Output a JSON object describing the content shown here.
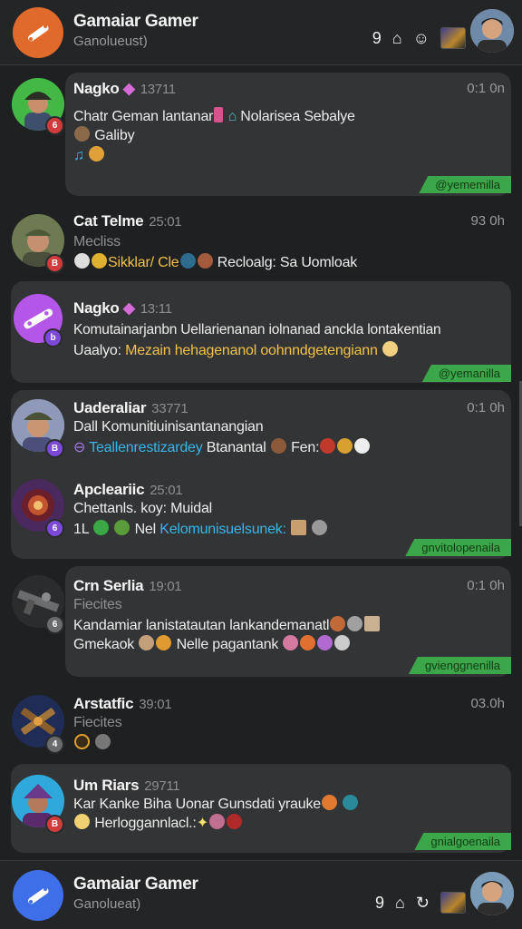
{
  "header": {
    "title": "Gamaiar Gamer",
    "subtitle": "Ganolueust)",
    "icon_q": "9",
    "logo_color": "#e06a2c"
  },
  "footer": {
    "title": "Gamaiar Gamer",
    "subtitle": "Ganolueat)",
    "icon_q": "9",
    "logo_color": "#3f6fe8"
  },
  "messages": [
    {
      "name": "Nagko",
      "time": "13711",
      "right": "0:1 0n",
      "lines": [
        "Chatr Geman lantanar",
        "Nolarisea Sebalye",
        "Galiby"
      ],
      "tag": "@yememilla"
    },
    {
      "name": "Cat Telme",
      "time": "25:01",
      "right": "93 0h",
      "sub": "Mecliss",
      "lines": [
        "Sikklar/ Cle",
        "Recloalg: Sa Uomloak"
      ]
    },
    {
      "name": "Nagko",
      "time": "13:11",
      "lines": [
        "Komutainarjanbn Uellarienanan iolnanad anckla lontakentian",
        "Uaalyo:",
        "Mezain hehagenanol oohnndgetengiann"
      ],
      "tag": "@yemanilla"
    },
    {
      "name": "Uaderaliar",
      "time": "33771",
      "right": "0:1 0h",
      "lines": [
        "Dall Komunitiuinisantanangian",
        "Teallenrestizardey",
        "Btanantal",
        "Fen:"
      ]
    },
    {
      "name": "Apcleariic",
      "time": "25:01",
      "lines": [
        "Chettanls. koy: Muidal",
        "1L",
        "Nel",
        "Kelomunisuelsunek:"
      ],
      "tag": "gnvitolopenaila"
    },
    {
      "name": "Crn Serlia",
      "time": "19:01",
      "right": "0:1 0h",
      "sub": "Fiecites",
      "lines": [
        "Kandamiar lanistatautan lankandemanatl",
        "Gmekaok",
        "Nelle pagantank"
      ],
      "tag": "gvienggnenilla"
    },
    {
      "name": "Arstatfic",
      "time": "39:01",
      "right": "03.0h",
      "sub": "Fiecites"
    },
    {
      "name": "Um Riars",
      "time": "29711",
      "lines": [
        "Kar Kanke Biha Uonar Gunsdati yrauke",
        "Herloggannlacl.:"
      ],
      "tag": "gnialgoenaila"
    }
  ],
  "colors": {
    "background": "#1f2021",
    "card": "#333435",
    "tag_green": "#3ca64a",
    "link_blue": "#35b7ea",
    "highlight_yellow": "#f2c24a",
    "badge_red": "#d23b3b",
    "badge_purple": "#7b48d8"
  }
}
